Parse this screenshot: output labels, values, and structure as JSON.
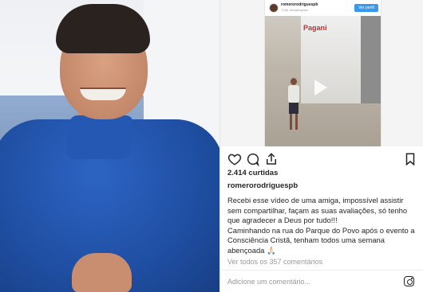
{
  "post": {
    "video": {
      "username": "romerorodriguespb",
      "views": "718K visualizações",
      "follow_label": "Ver perfil",
      "sign_text": "Pagani"
    },
    "likes": "2.414 curtidas",
    "username": "romerorodriguespb",
    "caption_lines": [
      "Recebi esse vídeo de uma amiga, impossível assistir",
      "sem compartilhar, façam as suas avaliações, só tenho",
      "que agradecer a Deus por tudo!!!",
      "Caminhando na rua do Parque do Povo após o evento a",
      "Consciência Cristã, tenham todos uma semana",
      "abençoada 🙏🏻"
    ],
    "view_comments": "Ver todos os 357 comentários",
    "add_comment_placeholder": "Adicione um comentário...",
    "icons": [
      "heart-icon",
      "comment-icon",
      "share-icon",
      "bookmark-icon",
      "instagram-icon"
    ]
  }
}
